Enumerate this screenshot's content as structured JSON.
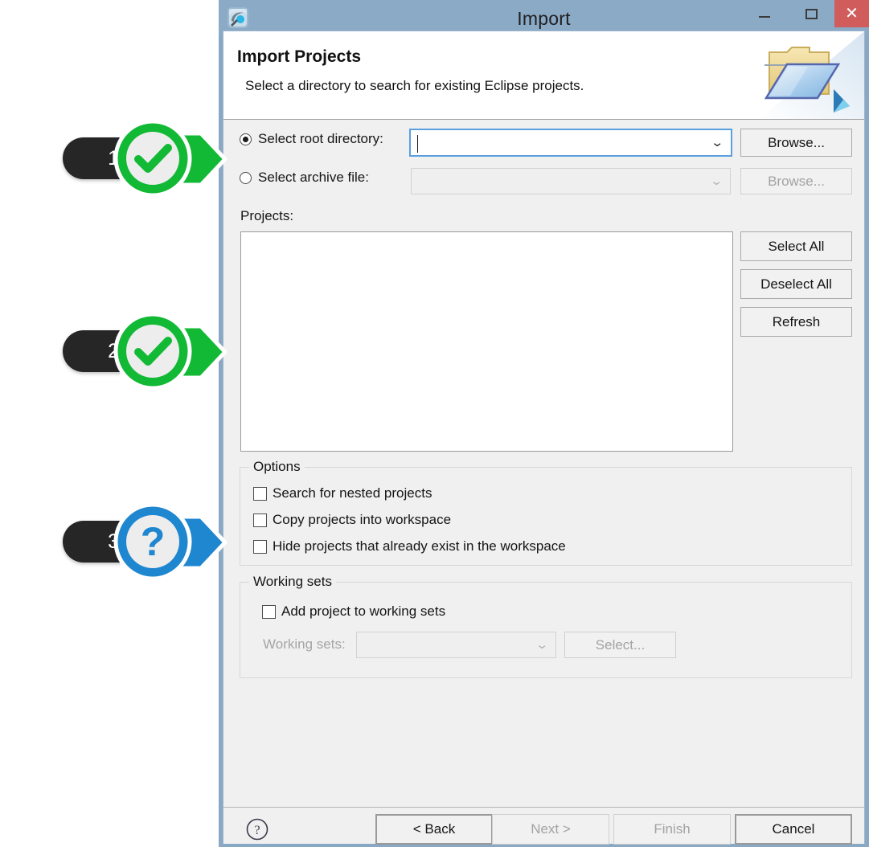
{
  "window": {
    "title": "Import",
    "app_icon": "eclipse-icon",
    "controls": {
      "minimize": "minimize-button",
      "maximize": "maximize-button",
      "close": "✕"
    },
    "close_color": "#d05c5c",
    "titlebar_color": "#8aaac6"
  },
  "header": {
    "title": "Import Projects",
    "subtitle": "Select a directory to search for existing Eclipse projects.",
    "graphic": "import-folder-icon"
  },
  "form": {
    "root_directory": {
      "label": "Select root directory:",
      "selected": true,
      "value": "",
      "placeholder": "",
      "browse_label": "Browse...",
      "browse_enabled": true
    },
    "archive_file": {
      "label": "Select archive file:",
      "selected": false,
      "value": "",
      "placeholder": "",
      "browse_label": "Browse...",
      "browse_enabled": false
    },
    "projects_label": "Projects:",
    "projects_items": [],
    "list_buttons": [
      {
        "label": "Select All",
        "enabled": true
      },
      {
        "label": "Deselect All",
        "enabled": true
      },
      {
        "label": "Refresh",
        "enabled": true
      }
    ]
  },
  "options_group": {
    "title": "Options",
    "items": [
      {
        "label": "Search for nested projects",
        "checked": false
      },
      {
        "label": "Copy projects into workspace",
        "checked": false
      },
      {
        "label": "Hide projects that already exist in the workspace",
        "checked": false
      }
    ]
  },
  "working_sets_group": {
    "title": "Working sets",
    "checkbox": {
      "label": "Add project to working sets",
      "checked": false
    },
    "field_label": "Working sets:",
    "field_value": "",
    "field_enabled": false,
    "select_label": "Select...",
    "select_enabled": false
  },
  "footer": {
    "help_icon": "question-mark-icon",
    "buttons": [
      {
        "label": "< Back",
        "enabled": true,
        "default": true
      },
      {
        "label": "Next >",
        "enabled": false,
        "default": false
      },
      {
        "label": "Finish",
        "enabled": false,
        "default": false
      },
      {
        "label": "Cancel",
        "enabled": true,
        "default": true
      }
    ]
  },
  "annotations": [
    {
      "number": "1",
      "icon": "check-icon",
      "color": "#11b934",
      "target": "select-root-directory-row"
    },
    {
      "number": "2",
      "icon": "check-icon",
      "color": "#11b934",
      "target": "projects-list"
    },
    {
      "number": "3",
      "icon": "question-icon",
      "color": "#1f86d0",
      "target": "options-group"
    }
  ]
}
